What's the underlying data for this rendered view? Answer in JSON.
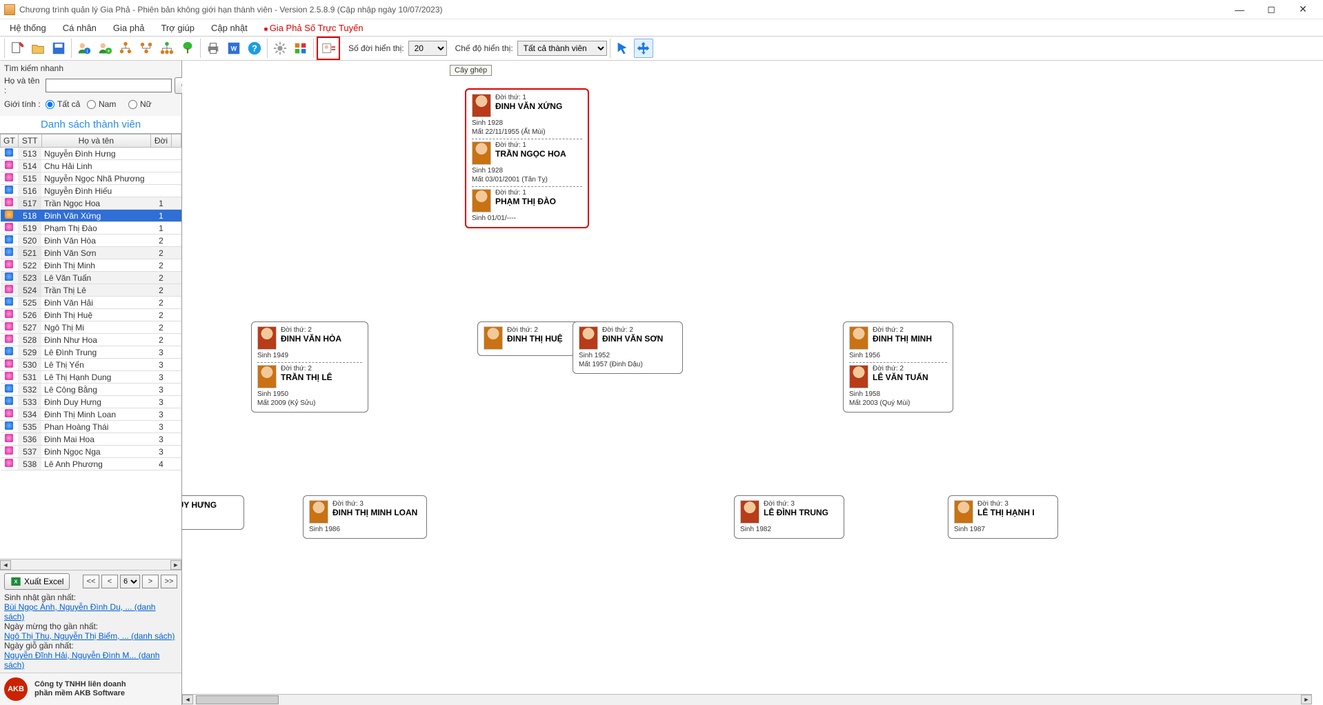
{
  "titlebar": {
    "title": "Chương trình quản lý Gia Phả - Phiên bản không giới hạn thành viên - Version 2.5.8.9 (Cập nhập ngày 10/07/2023)"
  },
  "menu": {
    "items": [
      "Hệ thống",
      "Cá nhân",
      "Gia phả",
      "Trợ giúp",
      "Cập nhật"
    ],
    "online": "Gia Phả Số Trực Tuyến"
  },
  "toolbar": {
    "gen_label": "Số đời hiển thị:",
    "gen_value": "20",
    "mode_label": "Chế độ hiển thị:",
    "mode_value": "Tất cả thành viên",
    "tooltip": "Cây ghép"
  },
  "sidebar": {
    "quick_search_label": "Tìm kiếm nhanh",
    "name_label": "Họ và tên :",
    "search_btn": "Tìm kiếm",
    "gender_label": "Giới tính :",
    "gender_all": "Tất cả",
    "gender_m": "Nam",
    "gender_f": "Nữ",
    "list_title": "Danh sách thành viên",
    "headers": {
      "gt": "GT",
      "stt": "STT",
      "name": "Họ và tên",
      "doi": "Đời"
    },
    "rows": [
      {
        "g": "m",
        "stt": "513",
        "name": "Nguyễn Đình Hưng",
        "doi": ""
      },
      {
        "g": "f",
        "stt": "514",
        "name": "Chu Hải Linh",
        "doi": ""
      },
      {
        "g": "f",
        "stt": "515",
        "name": "Nguyễn Ngọc Nhã Phương",
        "doi": ""
      },
      {
        "g": "m",
        "stt": "516",
        "name": "Nguyễn Đình Hiếu",
        "doi": ""
      },
      {
        "g": "f",
        "stt": "517",
        "name": "Trần Ngọc Hoa",
        "doi": "1",
        "alt": true
      },
      {
        "g": "c",
        "stt": "518",
        "name": "Đinh Văn Xứng",
        "doi": "1",
        "sel": true
      },
      {
        "g": "f",
        "stt": "519",
        "name": "Phạm Thị Đào",
        "doi": "1"
      },
      {
        "g": "m",
        "stt": "520",
        "name": "Đinh Văn Hòa",
        "doi": "2"
      },
      {
        "g": "m",
        "stt": "521",
        "name": "Đinh Văn Sơn",
        "doi": "2",
        "alt": true
      },
      {
        "g": "f",
        "stt": "522",
        "name": "Đinh Thị Minh",
        "doi": "2"
      },
      {
        "g": "m",
        "stt": "523",
        "name": "Lê Văn Tuấn",
        "doi": "2",
        "alt": true
      },
      {
        "g": "f",
        "stt": "524",
        "name": "Trần Thị Lê",
        "doi": "2",
        "alt": true
      },
      {
        "g": "m",
        "stt": "525",
        "name": "Đinh Văn Hải",
        "doi": "2"
      },
      {
        "g": "f",
        "stt": "526",
        "name": "Đinh Thị Huệ",
        "doi": "2"
      },
      {
        "g": "f",
        "stt": "527",
        "name": "Ngô Thị Mi",
        "doi": "2"
      },
      {
        "g": "f",
        "stt": "528",
        "name": "Đinh Như Hoa",
        "doi": "2"
      },
      {
        "g": "m",
        "stt": "529",
        "name": "Lê Đình Trung",
        "doi": "3"
      },
      {
        "g": "f",
        "stt": "530",
        "name": "Lê Thị Yến",
        "doi": "3"
      },
      {
        "g": "f",
        "stt": "531",
        "name": "Lê Thị Hạnh Dung",
        "doi": "3"
      },
      {
        "g": "m",
        "stt": "532",
        "name": "Lê Công Bằng",
        "doi": "3"
      },
      {
        "g": "m",
        "stt": "533",
        "name": "Đinh Duy Hưng",
        "doi": "3"
      },
      {
        "g": "f",
        "stt": "534",
        "name": "Đinh Thị Minh Loan",
        "doi": "3"
      },
      {
        "g": "m",
        "stt": "535",
        "name": "Phan Hoàng Thái",
        "doi": "3"
      },
      {
        "g": "f",
        "stt": "536",
        "name": "Đinh Mai Hoa",
        "doi": "3"
      },
      {
        "g": "f",
        "stt": "537",
        "name": "Đinh Ngọc Nga",
        "doi": "3"
      },
      {
        "g": "f",
        "stt": "538",
        "name": "Lê Anh Phương",
        "doi": "4"
      }
    ],
    "excel_label": "Xuất Excel",
    "page_value": "6",
    "info1_label": "Sinh nhật gần nhất:",
    "info1_link": "Bùi Ngọc Ánh, Nguyễn Đình Du, ... (danh sách)",
    "info2_label": "Ngày mừng thọ gần nhất:",
    "info2_link": "Ngô Thị Thu, Nguyễn Thị Biểm, ... (danh sách)",
    "info3_label": "Ngày giỗ gần nhất:",
    "info3_link": "Nguyễn Đĩnh Hải, Nguyễn Đình M... (danh sách)",
    "company1": "Công ty TNHH liên doanh",
    "company2": "phần mềm AKB Software",
    "akb": "AKB"
  },
  "tree": {
    "root": {
      "people": [
        {
          "gen": "Đời thứ: 1",
          "name": "ĐINH VĂN XỨNG",
          "av": "m",
          "info": "Sinh 1928\nMất 22/11/1955 (Ất Mùi)"
        },
        {
          "gen": "Đời thứ: 1",
          "name": "TRẦN NGỌC HOA",
          "av": "f",
          "info": "Sinh 1928\nMất 03/01/2001 (Tân Tỵ)"
        },
        {
          "gen": "Đời thứ: 1",
          "name": "PHẠM THỊ ĐÀO",
          "av": "f",
          "info": "Sinh 01/01/----"
        }
      ]
    },
    "c1": {
      "people": [
        {
          "gen": "Đời thứ: 2",
          "name": "ĐINH VĂN HÒA",
          "av": "m",
          "info": "Sinh 1949"
        },
        {
          "gen": "Đời thứ: 2",
          "name": "TRẦN THỊ LÊ",
          "av": "f",
          "info": "Sinh 1950\nMất 2009 (Kỷ Sửu)"
        }
      ]
    },
    "c2": {
      "people": [
        {
          "gen": "Đời thứ: 2",
          "name": "ĐINH THỊ HUỆ",
          "av": "f",
          "info": ""
        }
      ]
    },
    "c3": {
      "people": [
        {
          "gen": "Đời thứ: 2",
          "name": "ĐINH VĂN SƠN",
          "av": "m",
          "info": "Sinh 1952\nMất 1957 (Đinh Dậu)"
        }
      ]
    },
    "c4": {
      "people": [
        {
          "gen": "Đời thứ: 2",
          "name": "ĐINH THỊ MINH",
          "av": "f",
          "info": "Sinh 1956"
        },
        {
          "gen": "Đời thứ: 2",
          "name": "LÊ VĂN TUẤN",
          "av": "m",
          "info": "Sinh 1958\nMất 2003 (Quý Mùi)"
        }
      ]
    },
    "g1": {
      "people": [
        {
          "gen": "",
          "name": "H DUY HƯNG",
          "av": "m",
          "info": ""
        }
      ],
      "partial": true
    },
    "g2": {
      "people": [
        {
          "gen": "Đời thứ: 3",
          "name": "ĐINH THỊ MINH LOAN",
          "av": "f",
          "info": "Sinh 1986"
        }
      ]
    },
    "g3": {
      "people": [
        {
          "gen": "Đời thứ: 3",
          "name": "LÊ ĐÌNH TRUNG",
          "av": "m",
          "info": "Sinh 1982"
        }
      ]
    },
    "g4": {
      "people": [
        {
          "gen": "Đời thứ: 3",
          "name": "LÊ THỊ HẠNH I",
          "av": "f",
          "info": "Sinh 1987"
        }
      ],
      "partial": true
    }
  }
}
